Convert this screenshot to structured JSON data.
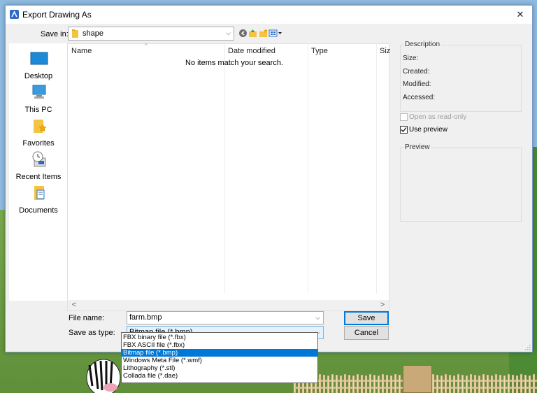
{
  "dialog": {
    "title": "Export Drawing As",
    "close_glyph": "✕"
  },
  "save_in": {
    "label": "Save in:",
    "value": "shape",
    "arrow": "⌵"
  },
  "toolbar_icons": [
    "back-icon",
    "up-folder-icon",
    "new-folder-icon",
    "view-menu-icon"
  ],
  "places": [
    {
      "label": "Desktop",
      "icon": "desktop-icon"
    },
    {
      "label": "This PC",
      "icon": "this-pc-icon"
    },
    {
      "label": "Favorites",
      "icon": "favorites-icon"
    },
    {
      "label": "Recent Items",
      "icon": "recent-items-icon"
    },
    {
      "label": "Documents",
      "icon": "documents-icon"
    }
  ],
  "file_list": {
    "columns": [
      "Name",
      "Date modified",
      "Type",
      "Siz"
    ],
    "empty_message": "No items match your search.",
    "scroll_left": "<",
    "scroll_right": ">"
  },
  "file_name": {
    "label": "File name:",
    "value": "farm.bmp"
  },
  "save_as_type": {
    "label": "Save as type:",
    "value": "Bitmap file (*.bmp)",
    "options": [
      "FBX binary file (*.fbx)",
      "FBX ASCII file (*.fbx)",
      "Bitmap file (*.bmp)",
      "Windows Meta File (*.wmf)",
      "Lithography (*.stl)",
      "Collada file (*.dae)"
    ],
    "selected_index": 2
  },
  "buttons": {
    "save": "Save",
    "cancel": "Cancel"
  },
  "description": {
    "legend": "Description",
    "size_label": "Size:",
    "created_label": "Created:",
    "modified_label": "Modified:",
    "accessed_label": "Accessed:"
  },
  "options": {
    "open_read_only": {
      "label": "Open as read-only",
      "checked": false,
      "enabled": false
    },
    "use_preview": {
      "label": "Use preview",
      "checked": true,
      "enabled": true
    }
  },
  "preview": {
    "legend": "Preview"
  },
  "colors": {
    "accent": "#0078d7",
    "title_icon": "#2d6bc4",
    "folder": "#f5c342"
  }
}
